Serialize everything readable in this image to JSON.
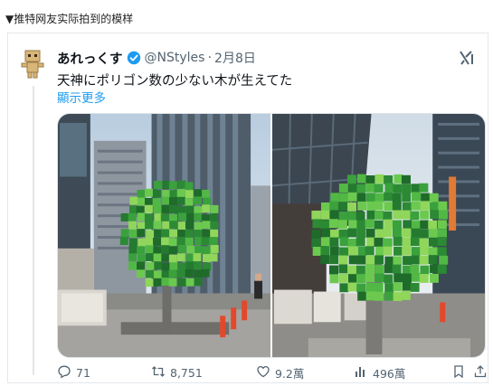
{
  "caption": "▼推特网友实际拍到的模样",
  "tweet": {
    "author_name": "あれっくす",
    "handle": "@NStyles",
    "separator": "·",
    "date": "2月8日",
    "text": "天神にポリゴン数の少ない木が生えてた",
    "show_more": "顯示更多"
  },
  "actions": {
    "replies": "71",
    "reposts": "8,751",
    "likes": "9.2萬",
    "views": "496萬"
  },
  "colors": {
    "accent": "#1d9bf0",
    "muted": "#536471",
    "text": "#0f1419"
  },
  "icons": {
    "verified": "verified-badge-icon",
    "grok": "grok-icon",
    "reply": "reply-icon",
    "repost": "repost-icon",
    "like": "heart-icon",
    "views": "bar-chart-icon",
    "bookmark": "bookmark-icon",
    "share": "share-icon"
  }
}
